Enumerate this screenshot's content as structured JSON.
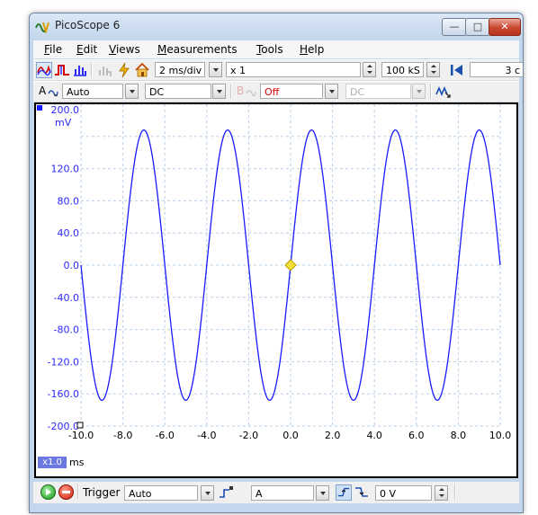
{
  "window": {
    "title": "PicoScope 6"
  },
  "menu": [
    "File",
    "Edit",
    "Views",
    "Measurements",
    "Tools",
    "Help"
  ],
  "toolbar": {
    "timebase": "2 ms/div",
    "zoom": "x 1",
    "samples": "100 kS",
    "captures_partial": "3 c"
  },
  "channels": {
    "a": {
      "label": "A",
      "range": "Auto",
      "coupling": "DC",
      "color": "#2a2aff"
    },
    "b": {
      "label": "B",
      "range": "Off",
      "coupling": "DC",
      "color": "#d40000"
    }
  },
  "trigger": {
    "label": "Trigger",
    "mode": "Auto",
    "source": "A",
    "threshold": "0 V"
  },
  "scope_view": {
    "y_unit": "mV",
    "x_unit": "ms",
    "x_zoom_badge": "x1.0",
    "y_ticks": [
      "200.0",
      "120.0",
      "80.0",
      "40.0",
      "0.0",
      "-40.0",
      "-80.0",
      "-120.0",
      "-160.0",
      "-200.0"
    ],
    "x_ticks": [
      "-10.0",
      "-8.0",
      "-6.0",
      "-4.0",
      "-2.0",
      "0.0",
      "2.0",
      "4.0",
      "6.0",
      "8.0",
      "10.0"
    ],
    "trace_color": "#1a1aff",
    "trigger_marker_color": "#f4e03a"
  },
  "chart_data": {
    "type": "line",
    "xlabel": "ms",
    "ylabel": "mV",
    "xlim": [
      -10,
      10
    ],
    "ylim": [
      -200,
      200
    ],
    "grid": true,
    "series": [
      {
        "name": "A",
        "amplitude_mV": 168,
        "frequency_kHz": 0.25,
        "phase_at_zero": "rising zero crossing"
      }
    ],
    "trigger_point": {
      "x": 0.0,
      "y": 0.0
    }
  }
}
